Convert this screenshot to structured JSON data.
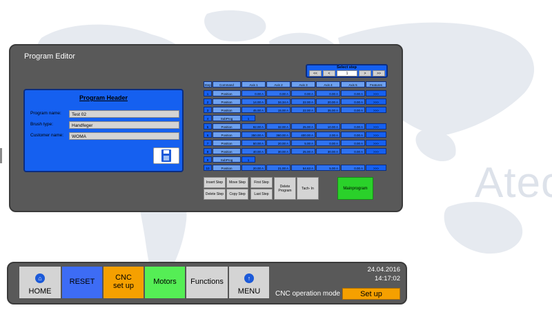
{
  "watermark": "Atec",
  "panel": {
    "title": "Program Editor"
  },
  "program_header": {
    "title": "Program Header",
    "fields": [
      {
        "label": "Program name:",
        "value": "Test 02"
      },
      {
        "label": "Brush type:",
        "value": "Handfeger"
      },
      {
        "label": "Customer name:",
        "value": "WOMA"
      }
    ],
    "save_icon": "floppy-disk-icon"
  },
  "select_step": {
    "title": "Select step",
    "first": "<<",
    "prev": "<",
    "value": "1",
    "next": ">",
    "last": ">>"
  },
  "table": {
    "headers": [
      "Step",
      "Command",
      "Axis 1",
      "Axis 2",
      "Axis 3",
      "Axis 4",
      "Axis 5",
      "Features"
    ],
    "rows": [
      {
        "step": "1",
        "command": "Position",
        "values": [
          "0.00 A",
          "0.00 A",
          "0.00 A",
          "0.00 A",
          "0.00 A"
        ],
        "features": ">>>"
      },
      {
        "step": "2",
        "command": "Position",
        "values": [
          "14.00 A",
          "34.34 A",
          "22.00 A",
          "20.00 A",
          "0.00 A"
        ],
        "features": ">>>"
      },
      {
        "step": "3",
        "command": "Position",
        "values": [
          "45.00 A",
          "15.00 A",
          "22.00 A",
          "35.00 A",
          "0.00 A"
        ],
        "features": ">>>"
      },
      {
        "step": "4",
        "command": "SubProg",
        "sub": "1"
      },
      {
        "step": "5",
        "command": "Position",
        "values": [
          "92.00 A",
          "32.00 A",
          "25.00 A",
          "10.00 A",
          "0.00 A"
        ],
        "features": ">>>"
      },
      {
        "step": "6",
        "command": "Position",
        "values": [
          "350.00 A",
          "360.00 A",
          "400.00 A",
          "2.00 A",
          "0.00 A"
        ],
        "features": ">>>"
      },
      {
        "step": "7",
        "command": "Position",
        "values": [
          "50.00 A",
          "20.00 A",
          "5.00 A",
          "0.00 A",
          "0.00 A"
        ],
        "features": ">>>"
      },
      {
        "step": "8",
        "command": "Position",
        "values": [
          "40.00 A",
          "30.00 A",
          "25.00 A",
          "30.00 A",
          "0.00 A"
        ],
        "features": ">>>"
      },
      {
        "step": "9",
        "command": "SubProg",
        "sub": "1"
      },
      {
        "step": "10",
        "command": "Position",
        "values": [
          "20.00 A",
          "21.00 A",
          "54.63 A",
          "5.00 A",
          "0.00 A"
        ],
        "features": ">>>"
      }
    ]
  },
  "step_buttons": {
    "insert_step": "Insert Step",
    "delete_step": "Delete Step",
    "move_step": "Move Step",
    "copy_step": "Copy Step",
    "first_step": "First Step",
    "last_step": "Last Step",
    "delete_program": "Delete Program",
    "tach_in": "Tach- In",
    "mainprogram": "Mainprogram"
  },
  "toolbar": {
    "home": "HOME",
    "reset": "RESET",
    "cnc_setup_line1": "CNC",
    "cnc_setup_line2": "set up",
    "motors": "Motors",
    "functions": "Functions",
    "menu": "MENU",
    "home_icon": "home-icon",
    "menu_icon": "menu-icon"
  },
  "status": {
    "date": "24.04.2016",
    "time": "14:17:02",
    "mode_label": "CNC operation mode",
    "mode_value": "Set up"
  },
  "colors": {
    "panel_bg": "#595959",
    "blue": "#1560f0",
    "light_blue": "#6da0ee",
    "orange": "#f5a000",
    "green": "#2ad12a",
    "reset_blue": "#3d6cf5",
    "motors_green": "#55ee55"
  }
}
